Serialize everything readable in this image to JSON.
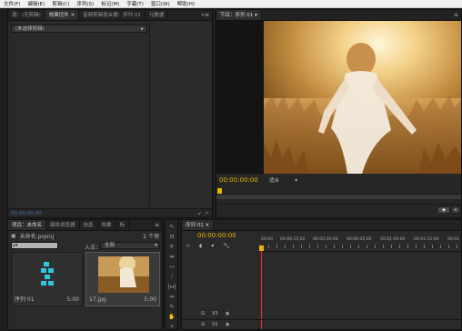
{
  "menubar": [
    "文件(F)",
    "编辑(E)",
    "剪辑(C)",
    "序列(S)",
    "标记(M)",
    "字幕(T)",
    "窗口(W)",
    "帮助(H)"
  ],
  "source_panel": {
    "tabs": [
      "源：(无剪辑)",
      "效果控件",
      "音频剪辑混合器：序列 01",
      "元数据"
    ],
    "clip_select": "(未选择剪辑)",
    "timecode": "00:00:00:00"
  },
  "program_monitor": {
    "tab": "节目：序列 01",
    "timecode": "00:00:00:00",
    "zoom": "适合"
  },
  "project_panel": {
    "tabs": [
      "项目：未命名",
      "媒体浏览器",
      "信息",
      "效果",
      "标"
    ],
    "filename": "未命名.prproj",
    "item_count": "2 个项",
    "in_label": "入点：",
    "in_value": "全部",
    "items": [
      {
        "name": "序列 01",
        "duration": "5:00"
      },
      {
        "name": "17.jpg",
        "duration": "5:00"
      }
    ]
  },
  "timeline": {
    "tab": "序列 01",
    "timecode": "00:00:00:00",
    "ruler": [
      "00:00",
      "00:00:15:00",
      "00:00:30:00",
      "00:00:45:00",
      "00:01:00:00",
      "00:01:15:00",
      "00:01"
    ],
    "tracks": [
      "V3",
      "V2"
    ]
  },
  "colors": {
    "accent": "#e8b400",
    "playhead": "#ff2a2a",
    "selection": "#3d7ac5"
  }
}
